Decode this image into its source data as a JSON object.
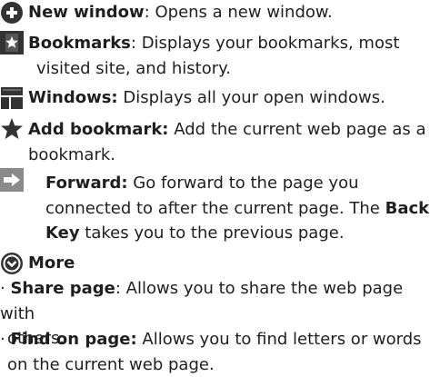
{
  "colors": {
    "text": "#1f1f1f",
    "icon_dark": "#333333",
    "icon_light": "#ffffff"
  },
  "items": [
    {
      "icon": "plus-circle-icon",
      "title": "New window",
      "separator": ": ",
      "description": "Opens a new window."
    },
    {
      "icon": "bookmark-star-icon",
      "title": "Bookmarks",
      "separator": ": ",
      "description_lines": [
        "Displays your bookmarks, most",
        "visited site, and history."
      ]
    },
    {
      "icon": "windows-icon",
      "title": "Windows:",
      "separator": " ",
      "description": "Displays all your open windows."
    },
    {
      "icon": "star-icon",
      "title": "Add bookmark:",
      "separator": " ",
      "description_lines": [
        "Add the current web page as a",
        "bookmark."
      ]
    },
    {
      "icon": "forward-arrow-icon",
      "title": "Forward:",
      "separator": " ",
      "line1_rest": "Go forward to the page you",
      "line2_prefix": "connected to after the current page. The ",
      "line2_bold": "Back",
      "line3_bold": "Key",
      "line3_rest": " takes you to the previous page."
    },
    {
      "icon": "chevron-down-circle-icon",
      "title": "More"
    }
  ],
  "bullets": [
    {
      "marker": "·",
      "title": "Share page",
      "separator": ": ",
      "description_lines": [
        "Allows you to share the web page with",
        "others."
      ]
    },
    {
      "marker": "·",
      "title": "Find on page:",
      "separator": " ",
      "description_lines": [
        "Allows you to find letters or words",
        "on the current web page."
      ]
    }
  ]
}
